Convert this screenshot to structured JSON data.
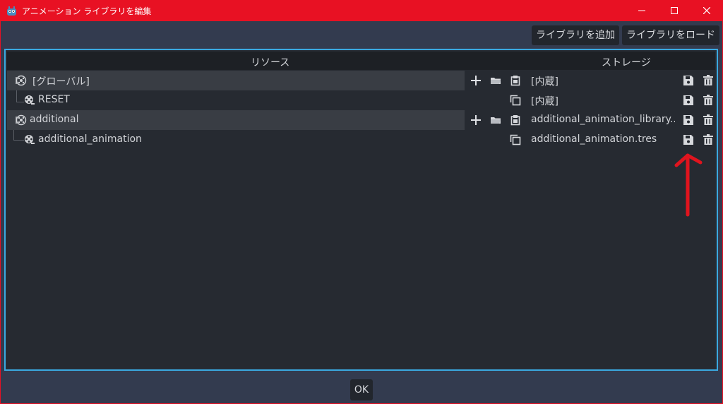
{
  "window": {
    "title": "アニメーション ライブラリを編集",
    "controls": [
      "minimize-icon",
      "maximize-icon",
      "close-icon"
    ]
  },
  "toolbar": {
    "add_library": "ライブラリを追加",
    "load_library": "ライブラリをロード"
  },
  "table": {
    "headers": {
      "resource": "リソース",
      "storage": "ストレージ"
    },
    "rows": [
      {
        "kind": "library",
        "name": "[グローバル]",
        "storage": "[内蔵]"
      },
      {
        "kind": "animation",
        "name": "RESET",
        "storage": "[内蔵]"
      },
      {
        "kind": "library",
        "name": "additional",
        "storage": "additional_animation_library...."
      },
      {
        "kind": "animation",
        "name": "additional_animation",
        "storage": "additional_animation.tres"
      }
    ]
  },
  "footer": {
    "ok": "OK"
  },
  "colors": {
    "titlebar": "#e81123",
    "panel_border": "#3aa9e0",
    "annotation_arrow": "#e0141e"
  }
}
